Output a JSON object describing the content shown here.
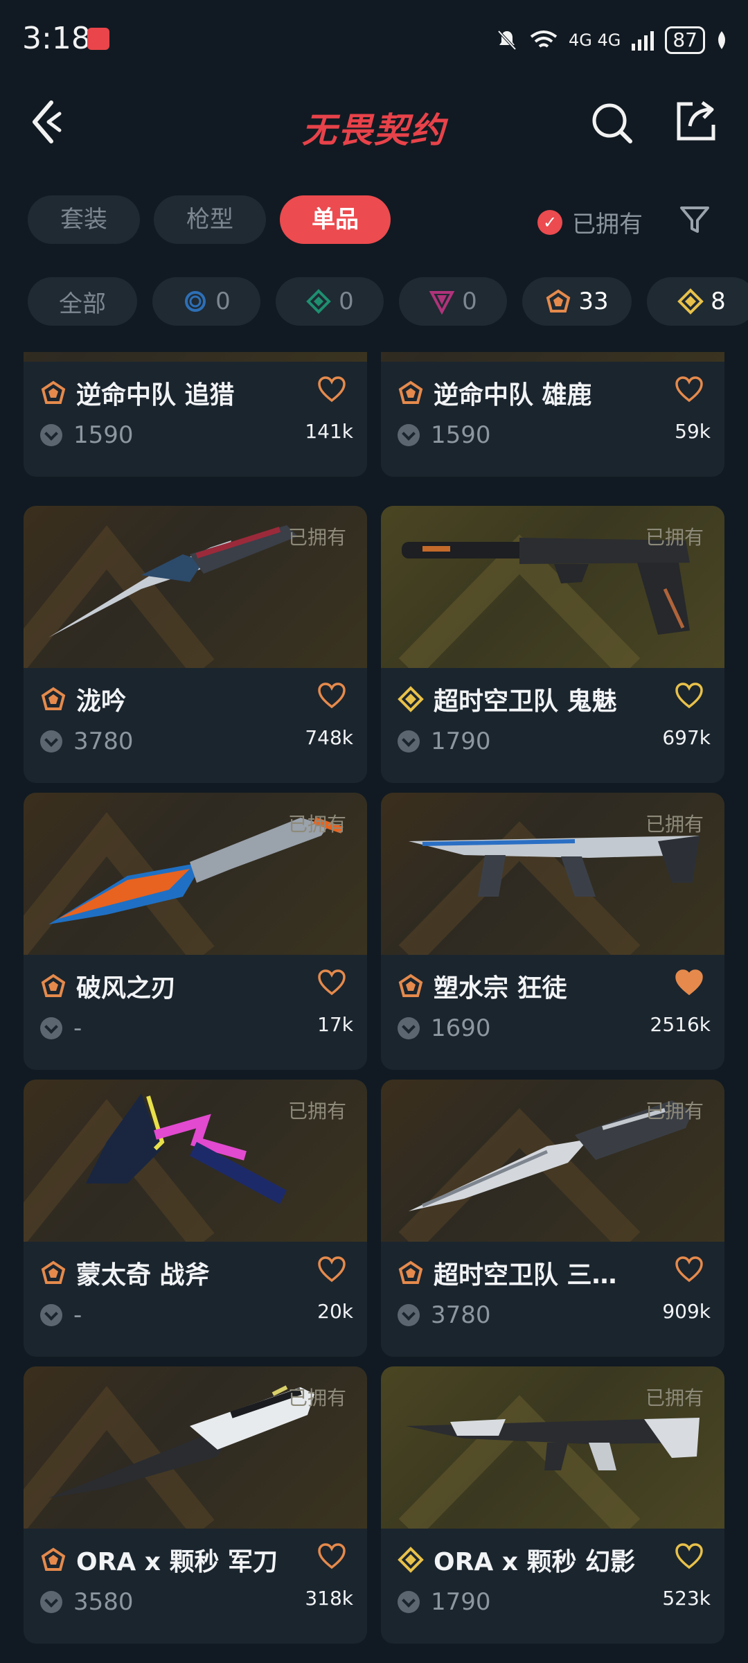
{
  "status_bar": {
    "time": "3:18",
    "battery": "87",
    "network": "4G 4G"
  },
  "header": {
    "logo": "无畏契约",
    "back_icon": "back-arrow-icon",
    "search_icon": "search-icon",
    "share_icon": "share-icon"
  },
  "tabs": [
    {
      "label": "套装"
    },
    {
      "label": "枪型"
    },
    {
      "label": "单品"
    }
  ],
  "owned_toggle": {
    "label": "已拥有",
    "checked": true
  },
  "rarity_filters": [
    {
      "label": "全部"
    },
    {
      "icon": "tier-blue-icon",
      "count": "0",
      "color": "#2d6fb6"
    },
    {
      "icon": "tier-green-icon",
      "count": "0",
      "color": "#1e8f6f"
    },
    {
      "icon": "tier-pink-icon",
      "count": "0",
      "color": "#b0337a"
    },
    {
      "icon": "tier-orange-icon",
      "count": "33",
      "color": "#e58a4c"
    },
    {
      "icon": "tier-gold-icon",
      "count": "8",
      "color": "#e8c14a"
    }
  ],
  "items": [
    {
      "name": "逆命中队 追猎",
      "price": "1590",
      "likes": "141k",
      "tier": "orange",
      "owned": "",
      "liked": false
    },
    {
      "name": "逆命中队 雄鹿",
      "price": "1590",
      "likes": "59k",
      "tier": "orange",
      "owned": "",
      "liked": false
    },
    {
      "name": "泷吟",
      "price": "3780",
      "likes": "748k",
      "tier": "orange",
      "owned": "已拥有",
      "liked": false
    },
    {
      "name": "超时空卫队 鬼魅",
      "price": "1790",
      "likes": "697k",
      "tier": "gold",
      "owned": "已拥有",
      "liked": false
    },
    {
      "name": "破风之刃",
      "price": "-",
      "likes": "17k",
      "tier": "orange",
      "owned": "已拥有",
      "liked": false
    },
    {
      "name": "塑水宗 狂徒",
      "price": "1690",
      "likes": "2516k",
      "tier": "orange",
      "owned": "已拥有",
      "liked": true
    },
    {
      "name": "蒙太奇 战斧",
      "price": "-",
      "likes": "20k",
      "tier": "orange",
      "owned": "已拥有",
      "liked": false
    },
    {
      "name": "超时空卫队 三…",
      "price": "3780",
      "likes": "909k",
      "tier": "orange",
      "owned": "已拥有",
      "liked": false
    },
    {
      "name": "ORA x 颗秒 军刀",
      "price": "3580",
      "likes": "318k",
      "tier": "orange",
      "owned": "已拥有",
      "liked": false
    },
    {
      "name": "ORA x 颗秒 幻影",
      "price": "1790",
      "likes": "523k",
      "tier": "gold",
      "owned": "已拥有",
      "liked": false
    }
  ],
  "colors": {
    "accent": "#ec4b4f",
    "tier_orange": "#e58a4c",
    "tier_gold": "#e8c14a",
    "background": "#111a22"
  }
}
